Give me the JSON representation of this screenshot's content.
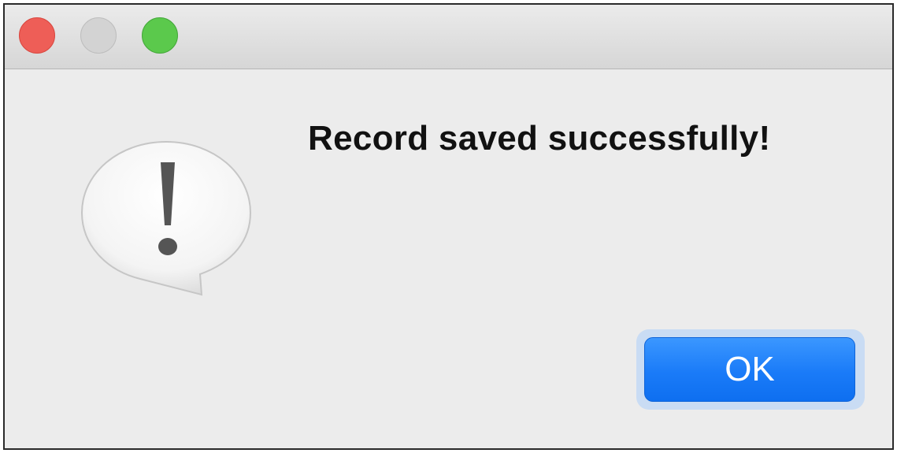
{
  "window": {
    "controls": {
      "close": "close-button",
      "minimize": "minimize-button",
      "zoom": "zoom-button"
    }
  },
  "dialog": {
    "icon": "alert-speech-bubble-icon",
    "message": "Record saved successfully!",
    "ok_label": "OK"
  },
  "colors": {
    "close": "#ee5e57",
    "minimize": "#d3d3d3",
    "zoom": "#5bc94c",
    "accent": "#1a7bf8"
  }
}
